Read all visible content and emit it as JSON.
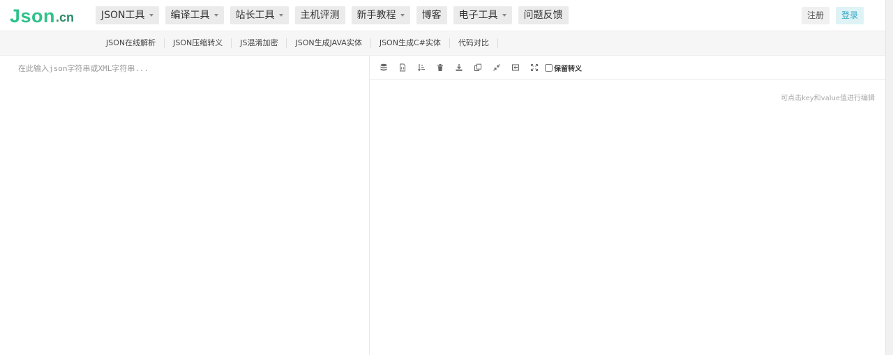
{
  "logo": {
    "main": "Json",
    "tld": ".cn"
  },
  "nav": [
    {
      "label": "JSON工具",
      "dropdown": true
    },
    {
      "label": "编译工具",
      "dropdown": true
    },
    {
      "label": "站长工具",
      "dropdown": true
    },
    {
      "label": "主机评测",
      "dropdown": false
    },
    {
      "label": "新手教程",
      "dropdown": true
    },
    {
      "label": "博客",
      "dropdown": false
    },
    {
      "label": "电子工具",
      "dropdown": true
    },
    {
      "label": "问题反馈",
      "dropdown": false
    }
  ],
  "auth": {
    "register": "注册",
    "login": "登录"
  },
  "subnav": [
    "JSON在线解析",
    "JSON压缩转义",
    "JS混淆加密",
    "JSON生成JAVA实体",
    "JSON生成C#实体",
    "代码对比"
  ],
  "editor": {
    "placeholder": "在此输入json字符串或XML字符串..."
  },
  "toolbar": {
    "icons": [
      "database-icon",
      "file-code-icon",
      "sort-icon",
      "trash-icon",
      "download-icon",
      "copy-icon",
      "compress-icon",
      "screenshot-icon",
      "fullscreen-icon"
    ],
    "keep_escape_label": "保留转义"
  },
  "result": {
    "hint": "可点击key和value值进行编辑"
  },
  "colors": {
    "brand": "#2fc28b",
    "login_bg": "#dff3f6",
    "login_text": "#3aa8c6"
  }
}
